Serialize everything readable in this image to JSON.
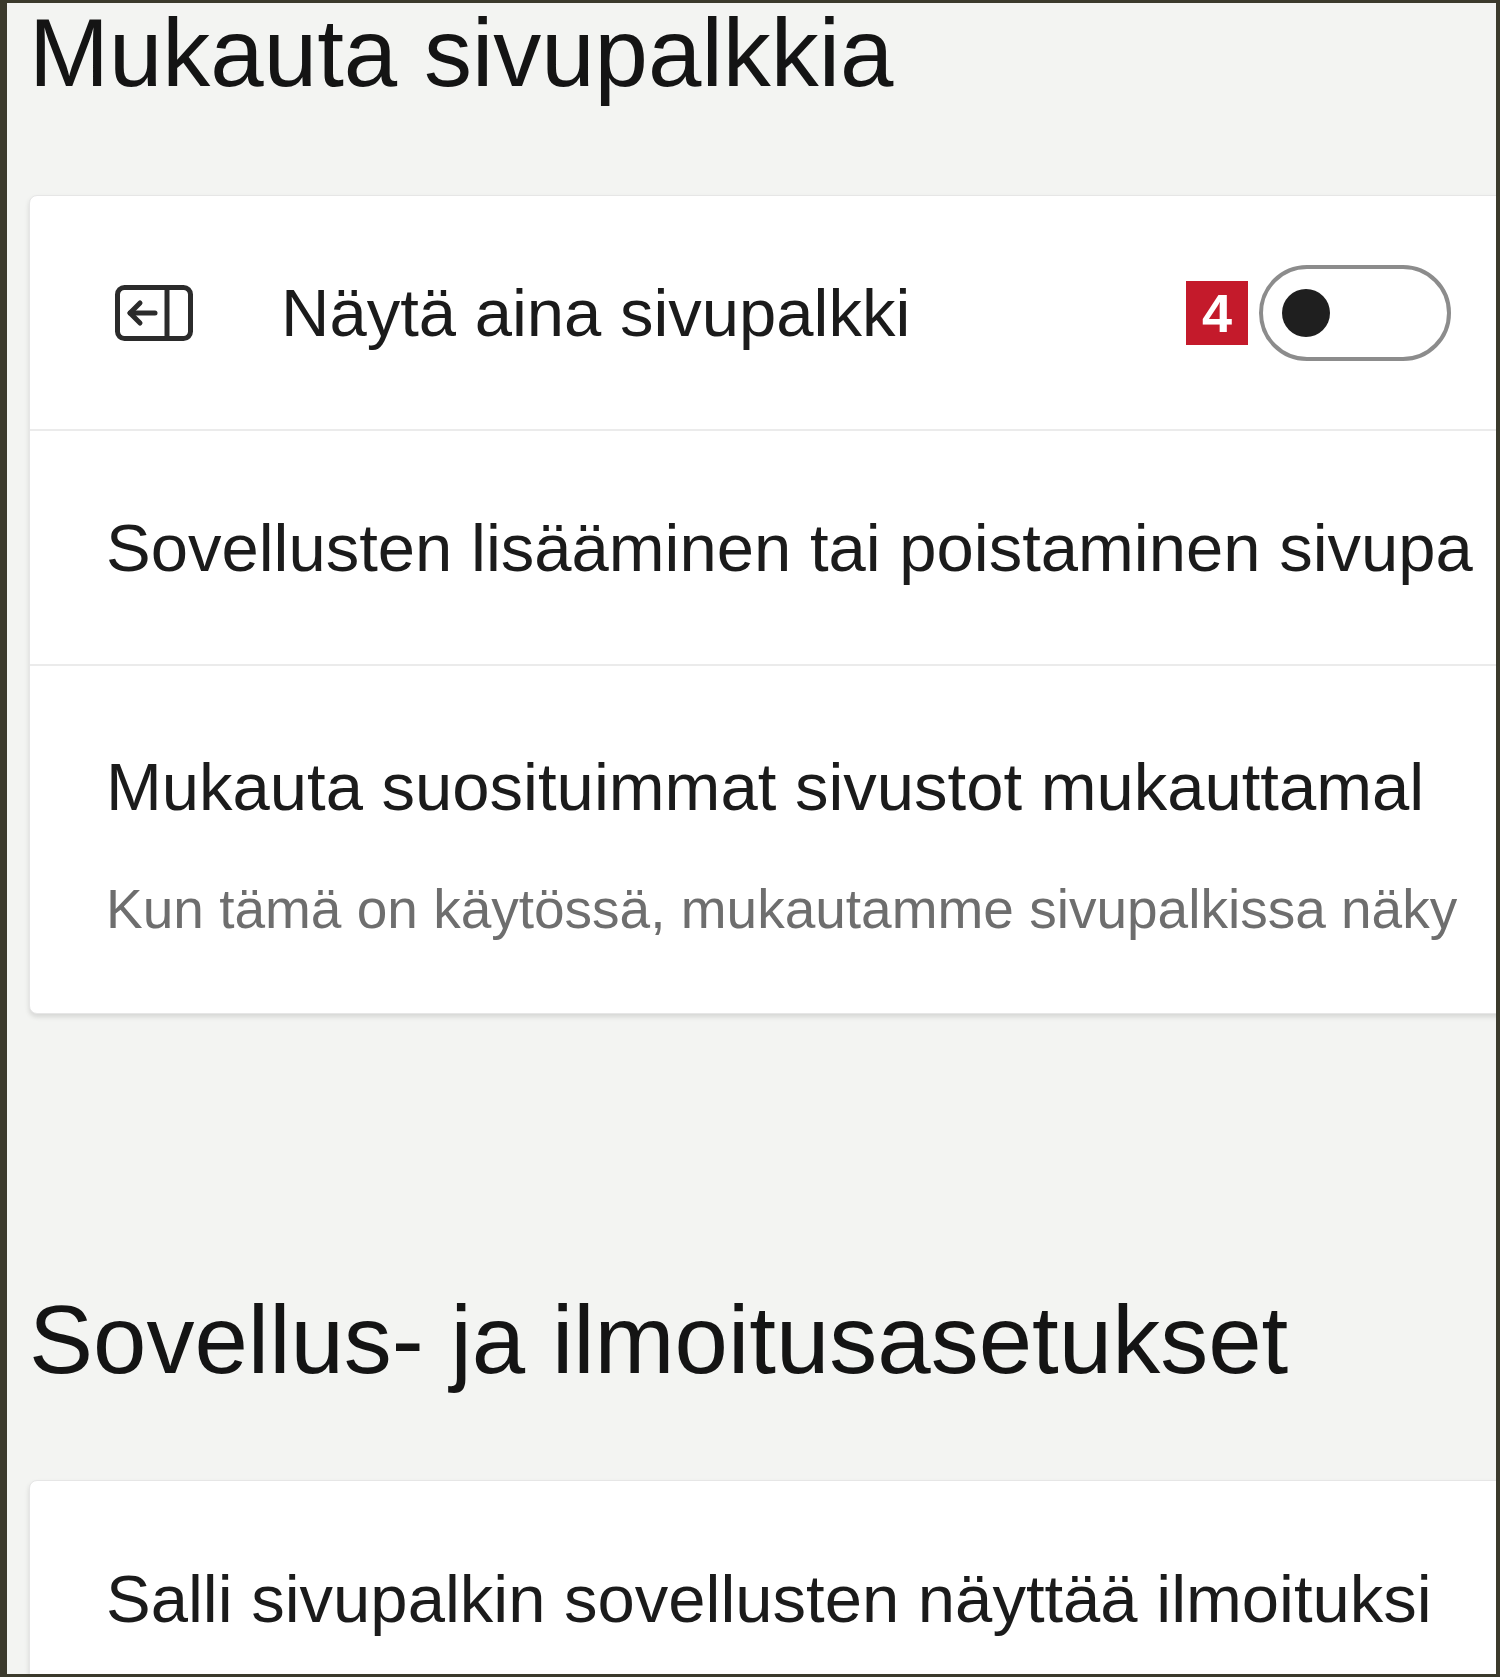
{
  "sections": [
    {
      "title": "Mukauta sivupalkkia",
      "rows": [
        {
          "kind": "toggle",
          "label": "Näytä aina sivupalkki",
          "callout": "4",
          "on": false
        },
        {
          "kind": "link",
          "label": "Sovellusten lisääminen tai poistaminen sivupa"
        },
        {
          "kind": "detail",
          "label": "Mukauta suosituimmat sivustot mukauttamal",
          "description": "Kun tämä on käytössä, mukautamme sivupalkissa näky"
        }
      ]
    },
    {
      "title": "Sovellus- ja ilmoitusasetukset",
      "rows": [
        {
          "kind": "link",
          "label": "Salli sivupalkin sovellusten näyttää ilmoituksi"
        }
      ]
    }
  ]
}
